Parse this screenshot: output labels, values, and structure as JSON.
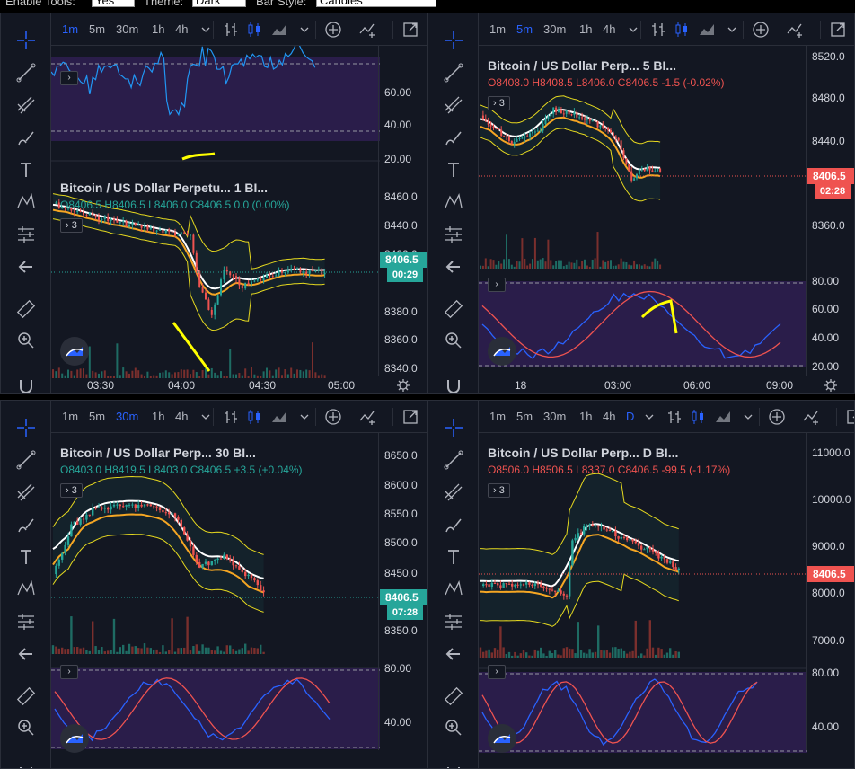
{
  "topbar": {
    "enable_tools_label": "Enable Tools:",
    "enable_tools_value": "Yes",
    "theme_label": "Theme:",
    "theme_value": "Dark",
    "bar_style_label": "Bar Style:",
    "bar_style_value": "Candles"
  },
  "toolbar": {
    "timeframes": [
      "1m",
      "5m",
      "30m",
      "1h",
      "4h"
    ],
    "daily": "D"
  },
  "colors": {
    "up": "#26a69a",
    "down": "#ef5350",
    "accent": "#2962ff",
    "annotation": "#ffff00",
    "oscillator_bg": "#2a1d4a"
  },
  "panels": [
    {
      "id": "tl",
      "active_tf": "1m",
      "title": "Bitcoin / US Dollar Perpetu...",
      "interval": "1",
      "exchange": "BI...",
      "ohlc": {
        "o": "O8406.5",
        "h": "H8406.5",
        "l": "L8406.0",
        "c": "C8406.5",
        "chg": "0.0 (0.00%)",
        "dir": "up"
      },
      "indicators_count": "3",
      "price_tag": "8406.5",
      "time_tag": "00:29",
      "y_labels": [
        "60.00",
        "40.00",
        "20.00",
        "8460.0",
        "8440.0",
        "8420.0",
        "8380.0",
        "8360.0",
        "8340.0"
      ],
      "x_labels": [
        "03:30",
        "04:00",
        "04:30",
        "05:00"
      ]
    },
    {
      "id": "tr",
      "active_tf": "5m",
      "title": "Bitcoin / US Dollar Perp...",
      "interval": "5",
      "exchange": "BI...",
      "ohlc": {
        "o": "O8408.0",
        "h": "H8408.5",
        "l": "L8406.0",
        "c": "C8406.5",
        "chg": "-1.5 (-0.02%)",
        "dir": "down"
      },
      "indicators_count": "3",
      "price_tag": "8406.5",
      "time_tag": "02:28",
      "y_labels": [
        "8520.0",
        "8480.0",
        "8440.0",
        "8360.0",
        "80.00",
        "60.00",
        "40.00",
        "20.00"
      ],
      "x_labels": [
        "18",
        "03:00",
        "06:00",
        "09:00"
      ]
    },
    {
      "id": "bl",
      "active_tf": "30m",
      "title": "Bitcoin / US Dollar Perp...",
      "interval": "30",
      "exchange": "BI...",
      "ohlc": {
        "o": "O8403.0",
        "h": "H8419.5",
        "l": "L8403.0",
        "c": "C8406.5",
        "chg": "+3.5 (+0.04%)",
        "dir": "up"
      },
      "indicators_count": "3",
      "price_tag": "8406.5",
      "time_tag": "07:28",
      "y_labels": [
        "8650.0",
        "8600.0",
        "8550.0",
        "8500.0",
        "8450.0",
        "8350.0",
        "80.00",
        "40.00"
      ],
      "x_labels": []
    },
    {
      "id": "br",
      "active_tf": "D",
      "title": "Bitcoin / US Dollar Perp...",
      "interval": "D",
      "exchange": "BI...",
      "ohlc": {
        "o": "O8506.0",
        "h": "H8506.5",
        "l": "L8337.0",
        "c": "C8406.5",
        "chg": "-99.5 (-1.17%)",
        "dir": "down"
      },
      "indicators_count": "3",
      "price_tag": "8406.5",
      "time_tag": "",
      "y_labels": [
        "11000.0",
        "10000.0",
        "9000.0",
        "8000.0",
        "7000.0",
        "80.00",
        "40.00"
      ],
      "x_labels": []
    }
  ]
}
